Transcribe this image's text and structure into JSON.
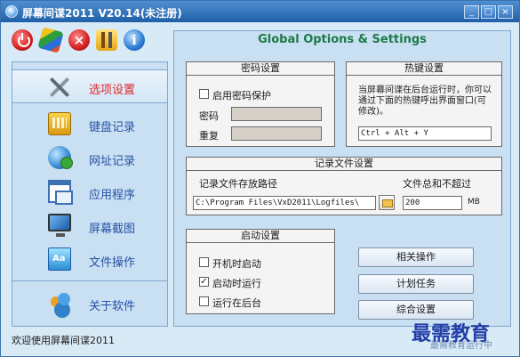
{
  "window": {
    "title": "屏幕间谍2011 V20.14(未注册)",
    "min": "_",
    "max": "□",
    "close": "×"
  },
  "toolbar": {
    "stop_glyph": "×",
    "info_glyph": "i"
  },
  "sidebar": {
    "items": [
      {
        "label": "选项设置",
        "icon": "wrench-icon",
        "active": true
      },
      {
        "label": "键盘记录",
        "icon": "keyboard-icon"
      },
      {
        "label": "网址记录",
        "icon": "globe-icon"
      },
      {
        "label": "应用程序",
        "icon": "window-icon"
      },
      {
        "label": "屏幕截图",
        "icon": "monitor-icon"
      },
      {
        "label": "文件操作",
        "icon": "file-icon"
      },
      {
        "label": "关于软件",
        "icon": "users-icon"
      }
    ]
  },
  "status": {
    "text": "欢迎使用屏幕间谍2011"
  },
  "main": {
    "title": "Global Options & Settings",
    "password": {
      "heading": "密码设置",
      "enable_label": "启用密码保护",
      "enable_checked": false,
      "password_label": "密码",
      "repeat_label": "重复",
      "password_value": "",
      "repeat_value": ""
    },
    "hotkey": {
      "heading": "热键设置",
      "description": "当屏幕间谍在后台运行时，你可以通过下面的热键呼出界面窗口(可修改)。",
      "value": "Ctrl + Alt + Y"
    },
    "logfile": {
      "heading": "记录文件设置",
      "path_label": "记录文件存放路径",
      "path_value": "C:\\Program Files\\VxD2011\\Logfiles\\",
      "size_label": "文件总和不超过",
      "size_value": "200",
      "unit": "MB"
    },
    "startup": {
      "heading": "启动设置",
      "options": [
        {
          "label": "开机时启动",
          "checked": false
        },
        {
          "label": "启动时运行",
          "checked": true
        },
        {
          "label": "运行在后台",
          "checked": false
        }
      ],
      "checked_glyph": "✓"
    },
    "actions": {
      "related": "相关操作",
      "plan": "计划任务",
      "general": "综合设置"
    }
  },
  "overlay": {
    "watermark": "最需教育",
    "faded_text": "最需教育运行中"
  },
  "colors": {
    "active_label": "#e0282d",
    "nav_label": "#2652a6",
    "title_bar": "#1f5fa8",
    "main_title": "#1c7a48"
  }
}
